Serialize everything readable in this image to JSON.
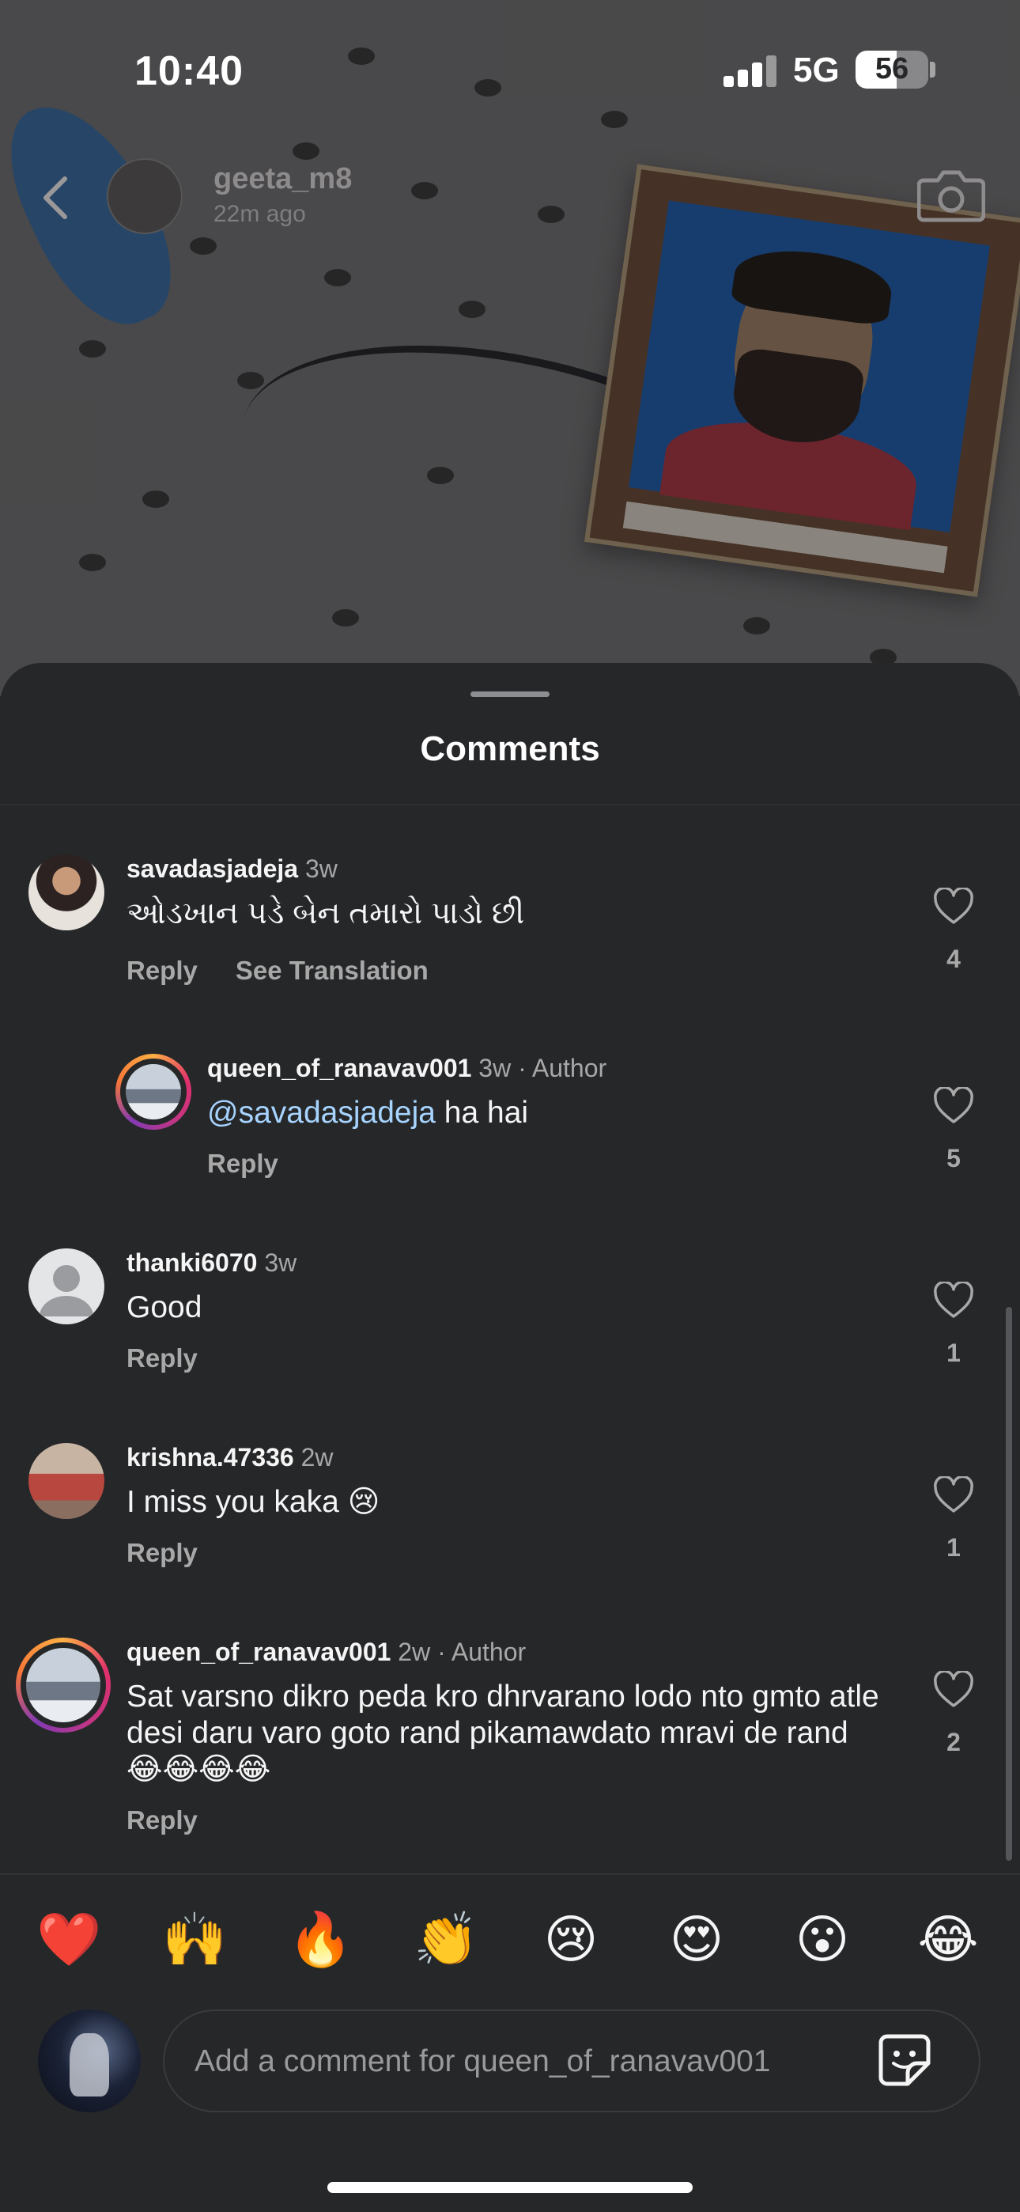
{
  "status_bar": {
    "time": "10:40",
    "network": "5G",
    "battery": "56",
    "battery_level": 0.56
  },
  "story": {
    "username": "geeta_m8",
    "time": "22m ago"
  },
  "sheet": {
    "title": "Comments"
  },
  "comments": [
    {
      "username": "savadasjadeja",
      "time": "3w",
      "text": "ઓડખાન પડે બેન તમારો પાડો છી",
      "reply": "Reply",
      "translate": "See Translation",
      "likes": "4"
    },
    {
      "username": "queen_of_ranavav001",
      "time": "3w",
      "author": "· Author",
      "mention": "@savadasjadeja",
      "text": " ha hai",
      "reply": "Reply",
      "likes": "5"
    },
    {
      "username": "thanki6070",
      "time": "3w",
      "text": "Good",
      "reply": "Reply",
      "likes": "1"
    },
    {
      "username": "krishna.47336",
      "time": "2w",
      "text": "I miss you kaka 😢",
      "reply": "Reply",
      "likes": "1"
    },
    {
      "username": "queen_of_ranavav001",
      "time": "2w",
      "author": "· Author",
      "text": "Sat varsno dikro peda kro dhrvarano lodo nto gmto atle desi daru varo goto rand pikamawdato mravi de rand 😂😂😂😂",
      "reply": "Reply",
      "likes": "2"
    }
  ],
  "emoji_bar": [
    "❤️",
    "🙌",
    "🔥",
    "👏",
    "😢",
    "😍",
    "😮",
    "😂"
  ],
  "composer": {
    "placeholder": "Add a comment for queen_of_ranavav001"
  },
  "icons": [
    "back-icon",
    "camera-icon",
    "heart-icon",
    "sticker-icon"
  ]
}
